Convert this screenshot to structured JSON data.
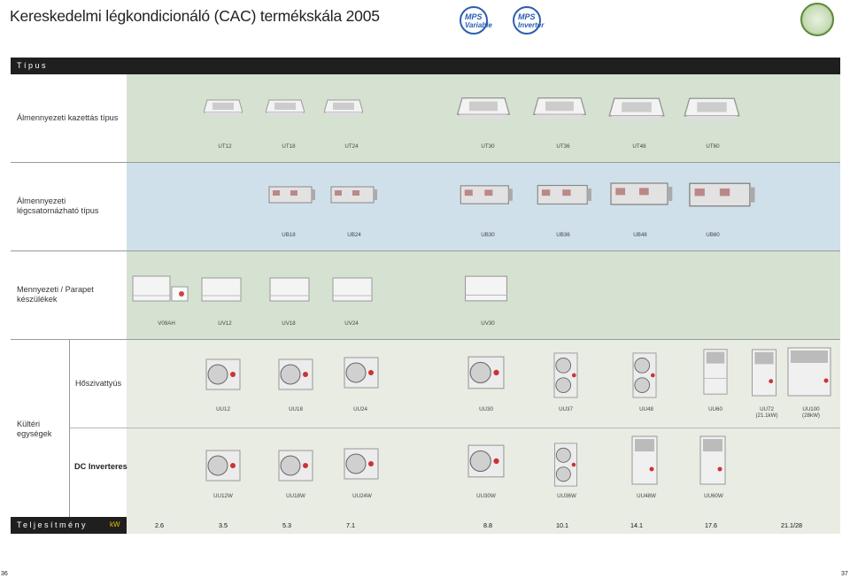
{
  "title": "Kereskedelmi légkondicionáló (CAC) termékskála  2005",
  "logos": [
    {
      "brand": "MPS",
      "line": "Variable",
      "color": "#2b5fb0"
    },
    {
      "brand": "MPS",
      "line": "Inverter",
      "color": "#2b5fb0"
    }
  ],
  "seal_icon": "certification-seal-icon",
  "header_label": "Típus",
  "colors": {
    "header_bg": "#1f1f1f",
    "green_band": "#d6e2d1",
    "blue_band": "#d0e0ea",
    "grey_band": "#e8ece2",
    "kw": "#e0c000"
  },
  "rows": {
    "cassette": {
      "label": "Álmennyezeti kazettás típus",
      "models": [
        "UT12",
        "UT18",
        "UT24",
        "UT30",
        "UT36",
        "UT48",
        "UT60"
      ]
    },
    "duct": {
      "label_line1": "Álmennyezeti",
      "label_line2": "légcsatornázható típus",
      "models": [
        "UB18",
        "UB24",
        "UB30",
        "UB36",
        "UB48",
        "UB60"
      ]
    },
    "ceiling": {
      "label_line1": "Mennyezeti / Parapet",
      "label_line2": "készülékek",
      "models": [
        "V09AH",
        "UV12",
        "UV18",
        "UV24",
        "UV30"
      ]
    },
    "outdoor": {
      "label_line1": "Kültéri",
      "label_line2": "egységek",
      "heatpump": {
        "label": "Hőszivattyús",
        "models": [
          "UU12",
          "UU18",
          "UU24",
          "UU30",
          "UU37",
          "UU48",
          "UU60"
        ],
        "model_uu72": [
          "UU72",
          "(21.1kW)"
        ],
        "model_uu100": [
          "UU100",
          "(28kW)"
        ]
      },
      "inverter": {
        "label": "DC Inverteres",
        "models": [
          "UU12W",
          "UU18W",
          "UU24W",
          "UU30W",
          "UU36W",
          "UU48W",
          "UU60W"
        ]
      }
    }
  },
  "footer": {
    "label": "Teljesítmény",
    "unit": "kW",
    "values": [
      "2.6",
      "3.5",
      "5.3",
      "7.1",
      "8.8",
      "10.1",
      "14.1",
      "17.6",
      "21.1/28"
    ]
  },
  "page_numbers": {
    "left": "36",
    "right": "37"
  }
}
